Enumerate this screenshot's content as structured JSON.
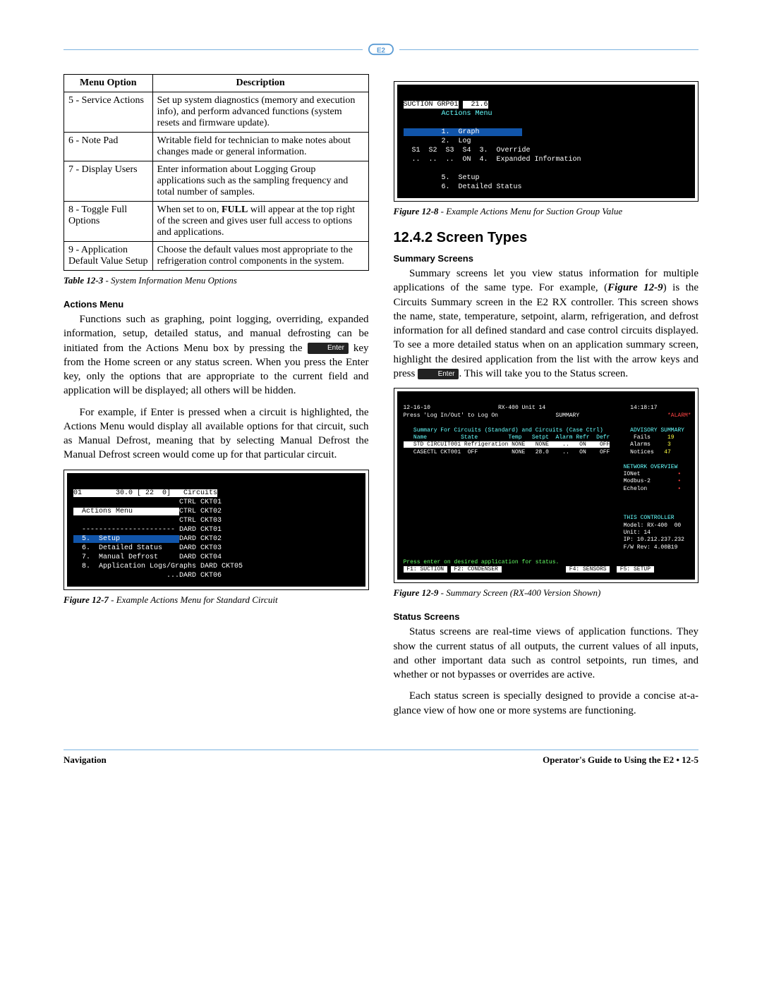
{
  "header_logo_alt": "E2",
  "table": {
    "headers": [
      "Menu Option",
      "Description"
    ],
    "rows": [
      {
        "opt": "5 - Service Actions",
        "desc": "Set up system diagnostics (memory and execution info), and perform advanced functions (system resets and firmware update)."
      },
      {
        "opt": "6 - Note Pad",
        "desc": "Writable field for technician to make notes about changes made or general information."
      },
      {
        "opt": "7 - Display Users",
        "desc": "Enter information about Logging Group applications such as the sampling frequency and total number of samples."
      },
      {
        "opt": "8 - Toggle Full Options",
        "desc_pre": "When set to on, ",
        "desc_bold": "FULL",
        "desc_post": " will appear at the top right of the screen and gives user full access to options and applications."
      },
      {
        "opt": "9 - Application Default Value Setup",
        "desc": "Choose the default values most appropriate to the refrigeration control components in the system."
      }
    ],
    "caption_label": "Table 12-3",
    "caption_text": " - System Information Menu Options"
  },
  "left": {
    "h_actions": "Actions Menu",
    "p1a": "Functions such as graphing, point logging, overriding, expanded information, setup, detailed status, and manual defrosting can be initiated from the Actions Menu box by pressing the ",
    "key1": "Enter",
    "p1b": " key from the Home screen or any status screen. When you press the Enter key, only the options that are appropriate to the current field and application will be displayed; all others will be hidden.",
    "p2": "For example, if Enter is pressed when a circuit is highlighted, the Actions Menu would display all available options for that circuit, such as Manual Defrost, meaning that by selecting Manual Defrost the Manual Defrost screen would come up for that particular circuit."
  },
  "fig7": {
    "caption_label": "Figure 12-7",
    "caption_text": " - Example Actions Menu for Standard Circuit",
    "top": "01        30.0 [ 22  0]   Circuits",
    "line0": "                         CTRL CKT01",
    "menu_title": "  Actions Menu           ",
    "line2": "CTRL CKT02",
    "line3": "                         CTRL CKT03",
    "dash": "  ---------------------- DARD CKT01",
    "i5": "  5.  Setup              ",
    "i5r": "DARD CKT02",
    "i6": "  6.  Detailed Status    DARD CKT03",
    "i7": "  7.  Manual Defrost     DARD CKT04",
    "i8": "  8.  Application Logs/Graphs",
    "i8r": "DARD CKT05",
    "bot": "                      ...DARD CKT06"
  },
  "fig8": {
    "caption_label": "Figure 12-8",
    "caption_text": " - Example Actions Menu for Suction Group Value",
    "title_l": "SUCTION GRP01",
    "title_r": "  21.6",
    "menu_title": "         Actions Menu",
    "m1": "         1.  Graph          ",
    "m2": "         2.  Log",
    "row_s": "  S1  S2  S3  S4",
    "m3": "3.  Override",
    "row_d": "  ..  ..  ..  ON",
    "m4": "4.  Expanded Information",
    "m5": "         5.  Setup",
    "m6": "         6.  Detailed Status"
  },
  "right": {
    "h_section": "12.4.2   Screen Types",
    "h_summary": "Summary Screens",
    "p1a": "Summary screens let you view status information for multiple applications of the same type. For example, (",
    "p1b_bold": "Figure 12-9",
    "p1c": ") is the Circuits Summary screen in the E2 RX controller. This screen shows the name, state, temperature, setpoint, alarm, refrigeration, and defrost information for all defined standard and case control circuits displayed. To see a more detailed status when on an application summary screen, highlight the desired application from the list with the arrow keys and press ",
    "key2": "Enter",
    "p1d": ". This will take you to the Status screen.",
    "h_status": "Status Screens",
    "p_s1": "Status screens are real-time views of application functions. They show the current status of all outputs, the current values of all inputs, and other important data such as control setpoints, run times, and whether or not bypasses or overrides are active.",
    "p_s2": "Each status screen is specially designed to provide a concise at-a-glance view of how one or more systems are functioning."
  },
  "fig9": {
    "caption_label": "Figure 12-9",
    "caption_text": " - Summary Screen (RX-400 Version Shown)",
    "hdr_l": "12-16-10  ",
    "hdr_c": "RX-400 Unit 14",
    "hdr_r": "14:18:17",
    "hdr2_l": "Press 'Log In/Out' to Log On",
    "hdr2_c": "SUMMARY",
    "title": "   Summary For Circuits (Standard) and Circuits (Case Ctrl)",
    "adv": "ADVISORY SUMMARY",
    "cols": "   Name          State         Temp   Setpt  Alarm Refr  Defr",
    "adv1": "Fails     ",
    "adv1n": "19",
    "row1": "   STD CIRCUIT001 Refrigeration NONE   NONE    ..   ON    OFF",
    "adv2": "Alarms    ",
    "adv2n": " 3",
    "row2": "   CASECTL CKT001  OFF          NONE   28.0    ..   ON    OFF",
    "adv3": "Notices   ",
    "adv3n": "47",
    "net": "NETWORK OVERVIEW",
    "n1": "IONet           ",
    "n2": "Modbus-2        ",
    "n3": "Echelon         ",
    "tc": "THIS CONTROLLER",
    "tc1": "Model: RX-400  00",
    "tc2": "Unit: 14",
    "tc3": "IP: 10.212.237.232",
    "tc4": "F/W Rev: 4.00B19",
    "hint": "Press enter on desired application for status.",
    "f1": " F1: SUCTION ",
    "f2": " F2: CONDENSER ",
    "f4": " F4: SENSORS ",
    "f5": " F5: SETUP "
  },
  "footer": {
    "left": "Navigation",
    "right": "Operator's Guide to Using the E2 • 12-5"
  }
}
